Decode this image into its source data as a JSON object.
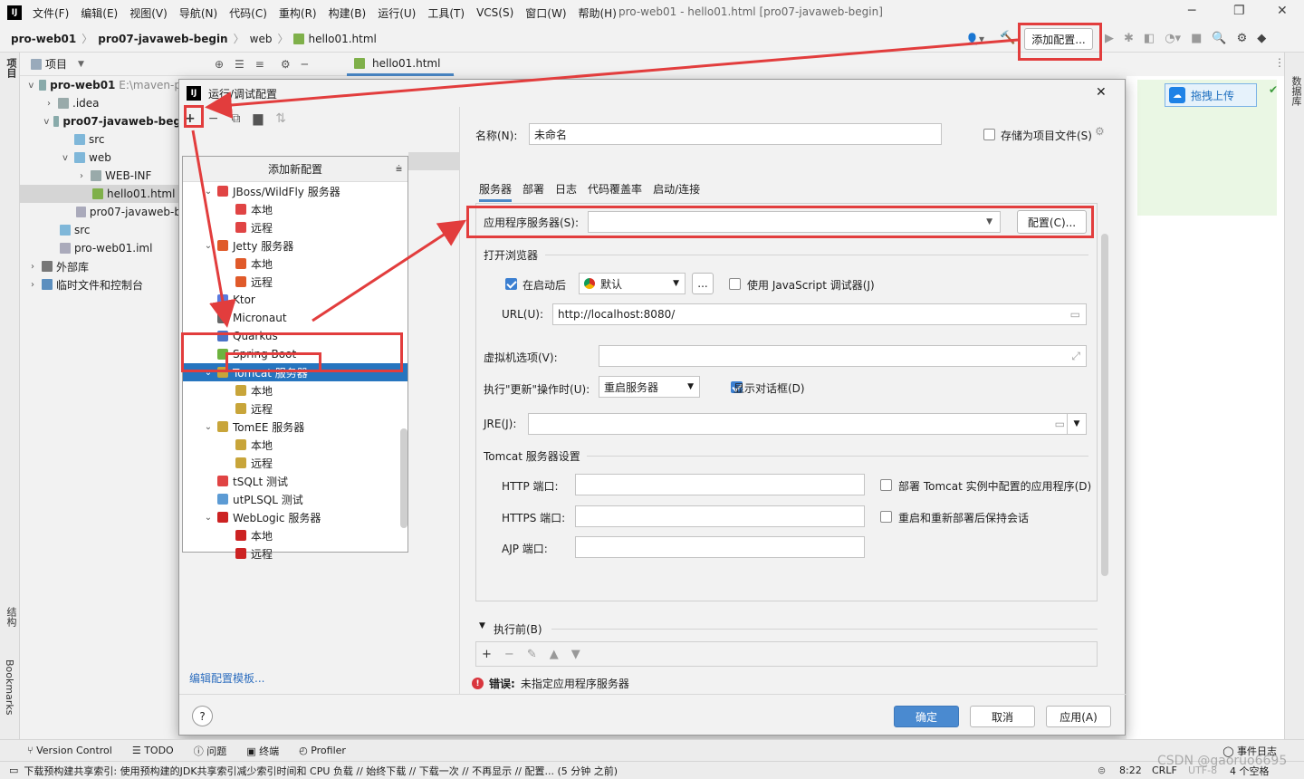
{
  "menubar": {
    "items": [
      "文件(F)",
      "编辑(E)",
      "视图(V)",
      "导航(N)",
      "代码(C)",
      "重构(R)",
      "构建(B)",
      "运行(U)",
      "工具(T)",
      "VCS(S)",
      "窗口(W)",
      "帮助(H)"
    ],
    "window_title": "pro-web01 - hello01.html [pro07-javaweb-begin]"
  },
  "navbar": {
    "crumbs": [
      "pro-web01",
      "pro07-javaweb-begin",
      "web",
      "hello01.html"
    ],
    "add_config": "添加配置..."
  },
  "project_panel": {
    "title": "项目",
    "tree": [
      {
        "label": "pro-web01",
        "hint": "E:\\maven-p"
      },
      {
        "label": ".idea"
      },
      {
        "label": "pro07-javaweb-beg"
      },
      {
        "label": "src"
      },
      {
        "label": "web"
      },
      {
        "label": "WEB-INF"
      },
      {
        "label": "hello01.html"
      },
      {
        "label": "pro07-javaweb-b"
      },
      {
        "label": "src"
      },
      {
        "label": "pro-web01.iml"
      },
      {
        "label": "外部库"
      },
      {
        "label": "临时文件和控制台"
      }
    ],
    "side_labels": {
      "project": "项目",
      "structure": "结构",
      "bookmarks": "Bookmarks",
      "database": "数据库"
    }
  },
  "editor": {
    "tab": "hello01.html",
    "upload": "拖拽上传"
  },
  "dialog": {
    "title": "运行/调试配置",
    "popup_title": "添加新配置",
    "popup_items": [
      {
        "label": "JBoss/WildFly 服务器",
        "level": 0,
        "expand": "v"
      },
      {
        "label": "本地",
        "level": 1
      },
      {
        "label": "远程",
        "level": 1
      },
      {
        "label": "Jetty 服务器",
        "level": 0,
        "expand": "v"
      },
      {
        "label": "本地",
        "level": 1
      },
      {
        "label": "远程",
        "level": 1
      },
      {
        "label": "Ktor",
        "level": 0
      },
      {
        "label": "Micronaut",
        "level": 0
      },
      {
        "label": "Quarkus",
        "level": 0
      },
      {
        "label": "Spring Boot",
        "level": 0
      },
      {
        "label": "Tomcat 服务器",
        "level": 0,
        "expand": "v",
        "selected": true
      },
      {
        "label": "本地",
        "level": 1
      },
      {
        "label": "远程",
        "level": 1
      },
      {
        "label": "TomEE 服务器",
        "level": 0,
        "expand": "v"
      },
      {
        "label": "本地",
        "level": 1
      },
      {
        "label": "远程",
        "level": 1
      },
      {
        "label": "tSQLt 测试",
        "level": 0
      },
      {
        "label": "utPLSQL 测试",
        "level": 0
      },
      {
        "label": "WebLogic 服务器",
        "level": 0,
        "expand": "v"
      },
      {
        "label": "本地",
        "level": 1
      },
      {
        "label": "远程",
        "level": 1
      }
    ],
    "edit_templates": "编辑配置模板...",
    "name_label": "名称(N):",
    "name_value": "未命名",
    "store_label": "存储为项目文件(S)",
    "tabs": [
      "服务器",
      "部署",
      "日志",
      "代码覆盖率",
      "启动/连接"
    ],
    "app_server_label": "应用程序服务器(S):",
    "configure_btn": "配置(C)...",
    "open_browser": "打开浏览器",
    "after_launch": "在启动后",
    "browser": "默认",
    "ellipsis": "...",
    "js_debugger": "使用 JavaScript 调试器(J)",
    "url_label": "URL(U):",
    "url_value": "http://localhost:8080/",
    "vm_label": "虚拟机选项(V):",
    "update_label": "执行\"更新\"操作时(U):",
    "update_value": "重启服务器",
    "show_dialog": "显示对话框(D)",
    "jre_label": "JRE(J):",
    "tomcat_settings": "Tomcat 服务器设置",
    "http_port": "HTTP 端口:",
    "https_port": "HTTPS 端口:",
    "ajp_port": "AJP 端口:",
    "deploy_apps": "部署 Tomcat 实例中配置的应用程序(D)",
    "keep_sessions": "重启和重新部署后保持会话",
    "before_launch": "执行前(B)",
    "error_prefix": "错误:",
    "error_text": "未指定应用程序服务器",
    "ok": "确定",
    "cancel": "取消",
    "apply": "应用(A)",
    "help": "?"
  },
  "toolwindows": [
    "Version Control",
    "TODO",
    "问题",
    "终端",
    "Profiler"
  ],
  "event_log": "事件日志",
  "status": {
    "message": "下载预构建共享索引: 使用预构建的JDK共享索引减少索引时间和 CPU 负载 // 始终下载 // 下载一次 // 不再显示 // 配置... (5 分钟 之前)",
    "time": "8:22",
    "crlf": "CRLF",
    "encoding": "UTF-8",
    "indent": "4 个空格",
    "watermark": "CSDN @gaoruo6695"
  },
  "colors": {
    "accent": "#4a88c7",
    "selection": "#2675bf",
    "annotation": "#e23d3d",
    "ok_button": "#4a8ad0"
  }
}
